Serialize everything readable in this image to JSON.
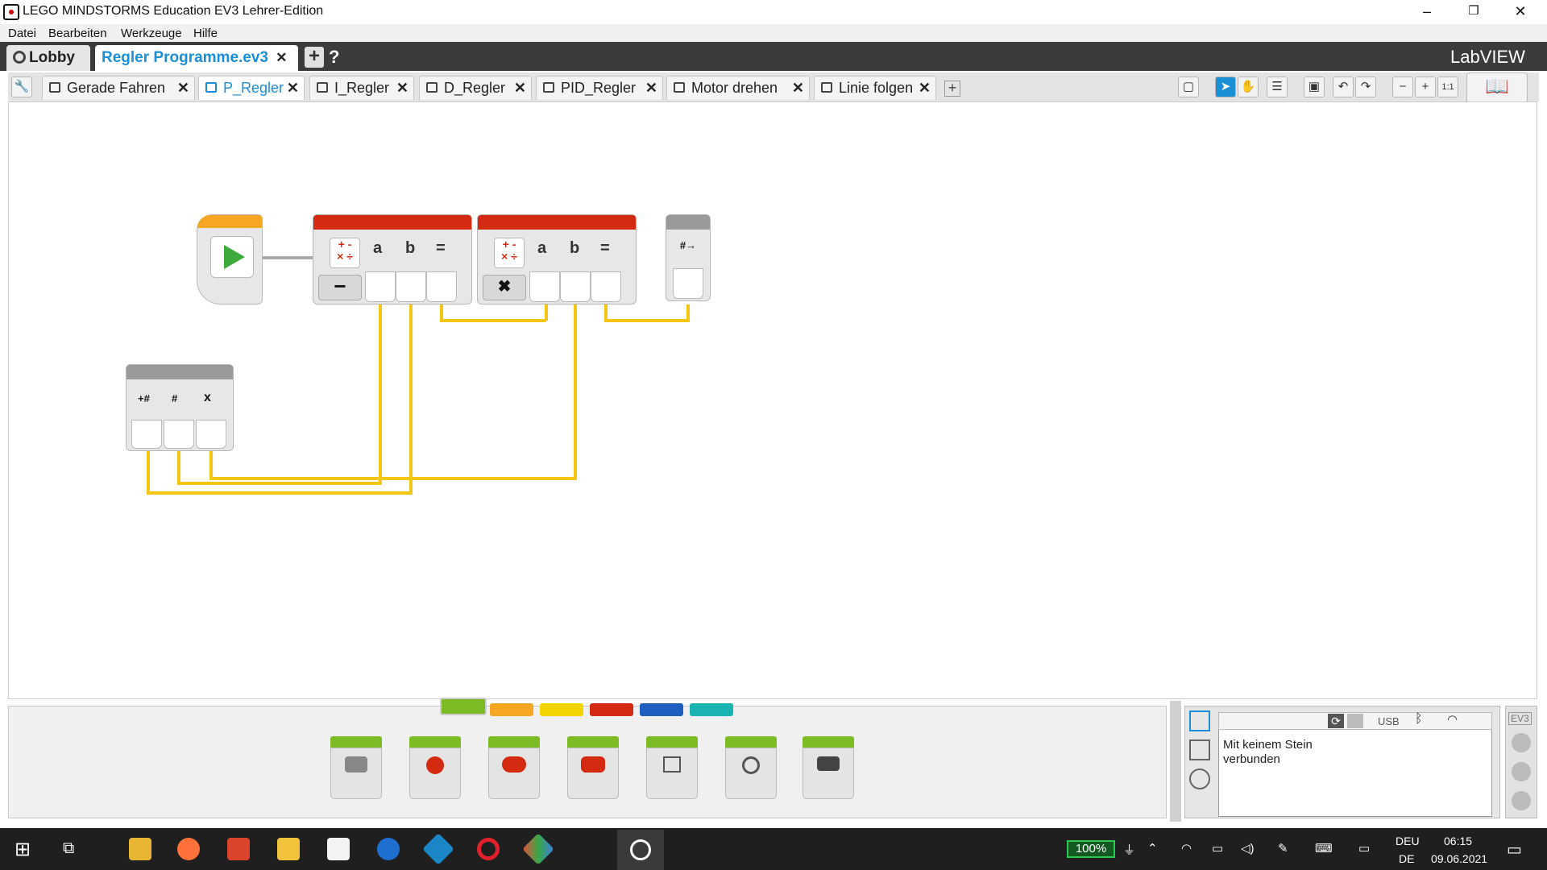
{
  "window": {
    "title": "LEGO MINDSTORMS Education EV3 Lehrer-Edition",
    "minimize": "–",
    "restore": "❐",
    "close": "✕"
  },
  "menu": [
    "Datei",
    "Bearbeiten",
    "Werkzeuge",
    "Hilfe"
  ],
  "project_bar": {
    "lobby": "Lobby",
    "project": "Regler Programme.ev3",
    "close": "✕",
    "add": "+",
    "help": "?",
    "brand": "LabVIEW"
  },
  "program_tabs": [
    {
      "label": "Gerade Fahren",
      "active": false
    },
    {
      "label": "P_Regler",
      "active": true
    },
    {
      "label": "I_Regler",
      "active": false
    },
    {
      "label": "D_Regler",
      "active": false
    },
    {
      "label": "PID_Regler",
      "active": false
    },
    {
      "label": "Motor drehen",
      "active": false
    },
    {
      "label": "Linie folgen",
      "active": false
    }
  ],
  "tab_add": "+",
  "canvas": {
    "math1": {
      "ops": "+ -\n× ÷",
      "a": "a",
      "b": "b",
      "eq": "=",
      "mode": "−"
    },
    "math2": {
      "ops": "+ -\n× ÷",
      "a": "a",
      "b": "b",
      "eq": "=",
      "mode": "✖"
    },
    "variable_in": {
      "icons": [
        "+#",
        "#",
        "x"
      ]
    }
  },
  "palette_colors": [
    "#7cbb24",
    "#f5a623",
    "#f2d400",
    "#d42a12",
    "#1f5fbf",
    "#19b3b1"
  ],
  "palette_blocks": [
    "medium-motor",
    "large-motor",
    "move-steering",
    "move-tank",
    "display",
    "sound",
    "brick-status-light"
  ],
  "hardware": {
    "status": "Mit keinem Stein verbunden",
    "usb": "USB",
    "ev3": "EV3"
  },
  "taskbar": {
    "battery": "100%",
    "lang1": "DEU",
    "lang2": "DE",
    "time": "06:15",
    "date": "09.06.2021"
  }
}
